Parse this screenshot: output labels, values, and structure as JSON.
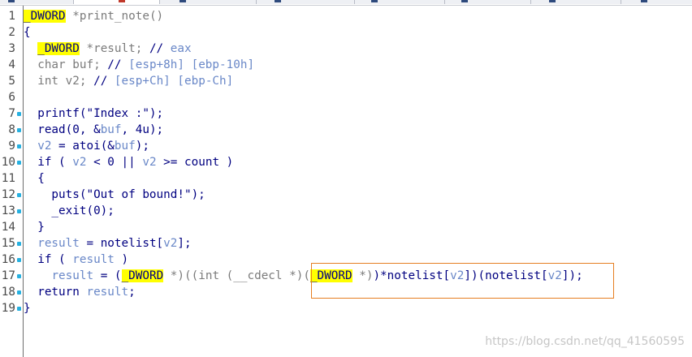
{
  "editor": {
    "lines": [
      {
        "n": "1",
        "dot": false,
        "t": [
          [
            "hl",
            "_DWORD"
          ],
          [
            "gr",
            " *print_note()"
          ]
        ]
      },
      {
        "n": "2",
        "dot": false,
        "t": [
          [
            "pl",
            "{"
          ]
        ]
      },
      {
        "n": "3",
        "dot": false,
        "t": [
          [
            "pl",
            "  "
          ],
          [
            "hl",
            "_DWORD"
          ],
          [
            "gr",
            " *result; "
          ],
          [
            "kw",
            "// "
          ],
          [
            "cm",
            "eax"
          ]
        ]
      },
      {
        "n": "4",
        "dot": false,
        "t": [
          [
            "pl",
            "  "
          ],
          [
            "gr",
            "char buf; "
          ],
          [
            "kw",
            "// "
          ],
          [
            "cm",
            "[esp+8h] [ebp-10h]"
          ]
        ]
      },
      {
        "n": "5",
        "dot": false,
        "t": [
          [
            "pl",
            "  "
          ],
          [
            "gr",
            "int v2; "
          ],
          [
            "kw",
            "// "
          ],
          [
            "cm",
            "[esp+Ch] [ebp-Ch]"
          ]
        ]
      },
      {
        "n": "6",
        "dot": false,
        "t": []
      },
      {
        "n": "7",
        "dot": true,
        "t": [
          [
            "pl",
            "  printf(\"Index :\");"
          ]
        ]
      },
      {
        "n": "8",
        "dot": true,
        "t": [
          [
            "pl",
            "  read(0, &"
          ],
          [
            "vr",
            "buf"
          ],
          [
            "pl",
            ", 4u);"
          ]
        ]
      },
      {
        "n": "9",
        "dot": true,
        "t": [
          [
            "pl",
            "  "
          ],
          [
            "vr",
            "v2"
          ],
          [
            "pl",
            " = atoi(&"
          ],
          [
            "vr",
            "buf"
          ],
          [
            "pl",
            ");"
          ]
        ]
      },
      {
        "n": "10",
        "dot": true,
        "t": [
          [
            "pl",
            "  if ( "
          ],
          [
            "vr",
            "v2"
          ],
          [
            "pl",
            " < 0 || "
          ],
          [
            "vr",
            "v2"
          ],
          [
            "pl",
            " >= count )"
          ]
        ]
      },
      {
        "n": "11",
        "dot": false,
        "t": [
          [
            "pl",
            "  {"
          ]
        ]
      },
      {
        "n": "12",
        "dot": true,
        "t": [
          [
            "pl",
            "    puts(\"Out of bound!\");"
          ]
        ]
      },
      {
        "n": "13",
        "dot": true,
        "t": [
          [
            "pl",
            "    _exit(0);"
          ]
        ]
      },
      {
        "n": "14",
        "dot": false,
        "t": [
          [
            "pl",
            "  }"
          ]
        ]
      },
      {
        "n": "15",
        "dot": true,
        "t": [
          [
            "pl",
            "  "
          ],
          [
            "vr",
            "result"
          ],
          [
            "pl",
            " = notelist["
          ],
          [
            "vr",
            "v2"
          ],
          [
            "pl",
            "];"
          ]
        ]
      },
      {
        "n": "16",
        "dot": true,
        "t": [
          [
            "pl",
            "  if ( "
          ],
          [
            "vr",
            "result"
          ],
          [
            "pl",
            " )"
          ]
        ]
      },
      {
        "n": "17",
        "dot": true,
        "t": [
          [
            "pl",
            "    "
          ],
          [
            "vr",
            "result"
          ],
          [
            "pl",
            " = ("
          ],
          [
            "hl",
            "_DWORD"
          ],
          [
            "gr",
            " *)((int (__cdecl *)("
          ],
          [
            "hl",
            "_DWORD"
          ],
          [
            "gr",
            " *)"
          ],
          [
            "pl",
            ")*notelist["
          ],
          [
            "vr",
            "v2"
          ],
          [
            "pl",
            "])(notelist["
          ],
          [
            "vr",
            "v2"
          ],
          [
            "pl",
            "]);"
          ]
        ]
      },
      {
        "n": "18",
        "dot": true,
        "t": [
          [
            "pl",
            "  return "
          ],
          [
            "vr",
            "result"
          ],
          [
            "pl",
            ";"
          ]
        ]
      },
      {
        "n": "19",
        "dot": true,
        "t": [
          [
            "pl",
            "}"
          ]
        ]
      }
    ]
  },
  "colors": {
    "highlight": "#ffff00",
    "keyword": "#000080",
    "variable": "#6a88c8",
    "type": "#7b7b7b",
    "gutter_dot": "#27b0e0",
    "annotation_box": "#e67e22"
  },
  "watermark": "https://blog.csdn.net/qq_41560595"
}
